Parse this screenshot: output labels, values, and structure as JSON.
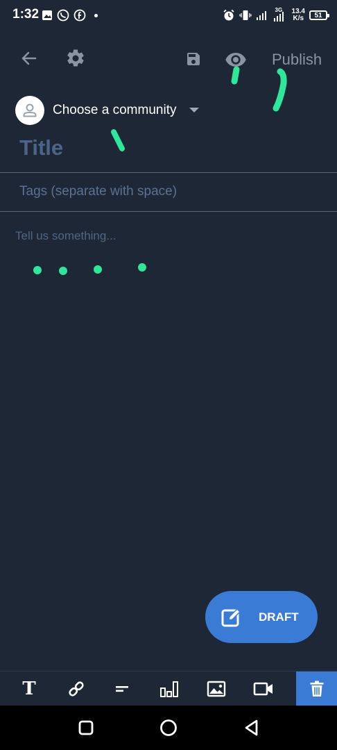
{
  "status_bar": {
    "time": "1:32",
    "network_type": "3G",
    "net_speed_value": "13.4",
    "net_speed_unit": "K/s",
    "battery": "51"
  },
  "toolbar": {
    "publish_label": "Publish"
  },
  "community": {
    "label": "Choose a community"
  },
  "editor": {
    "title_placeholder": "Title",
    "tags_placeholder": "Tags (separate with space)",
    "body_placeholder": "Tell us something..."
  },
  "fab": {
    "draft_label": "DRAFT"
  },
  "colors": {
    "background": "#1e2735",
    "accent": "#3a7bd5",
    "annotation": "#2ee89a"
  },
  "format_toolbar": {
    "icons": [
      "text-format-icon",
      "link-icon",
      "text-align-icon",
      "poll-icon",
      "image-icon",
      "video-icon",
      "trash-icon"
    ]
  }
}
